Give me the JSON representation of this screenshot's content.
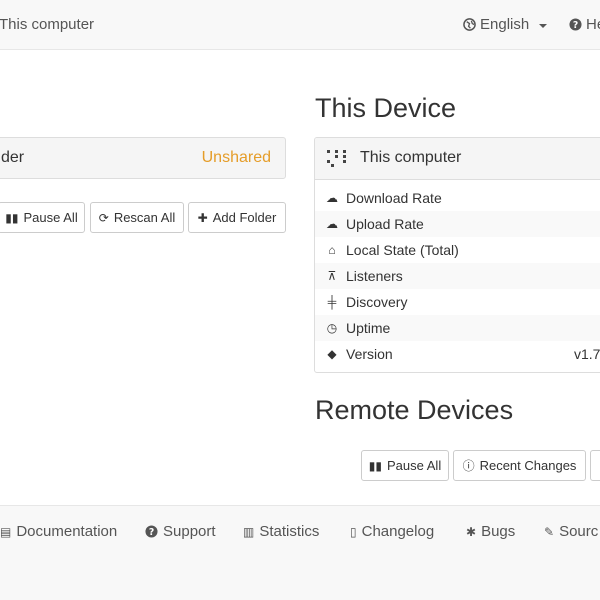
{
  "navbar": {
    "device_name": "This computer",
    "language": "English",
    "help": "He"
  },
  "folder": {
    "name": "der",
    "status": "Unshared"
  },
  "folder_actions": {
    "pause_all": "Pause All",
    "rescan_all": "Rescan All",
    "add_folder": "Add Folder"
  },
  "this_device": {
    "heading": "This Device",
    "name": "This computer",
    "rows": [
      {
        "label": "Download Rate",
        "value": ""
      },
      {
        "label": "Upload Rate",
        "value": ""
      },
      {
        "label": "Local State (Total)",
        "value": ""
      },
      {
        "label": "Listeners",
        "value": ""
      },
      {
        "label": "Discovery",
        "value": ""
      },
      {
        "label": "Uptime",
        "value": ""
      },
      {
        "label": "Version",
        "value": "v1.7"
      }
    ]
  },
  "remote_devices": {
    "heading": "Remote Devices",
    "pause_all": "Pause All",
    "recent_changes": "Recent Changes"
  },
  "footer": {
    "documentation": "Documentation",
    "support": "Support",
    "statistics": "Statistics",
    "changelog": "Changelog",
    "bugs": "Bugs",
    "source": "Sourc"
  },
  "colors": {
    "unshared": "#e59d29",
    "navbar_bg": "#f8f8f8"
  }
}
